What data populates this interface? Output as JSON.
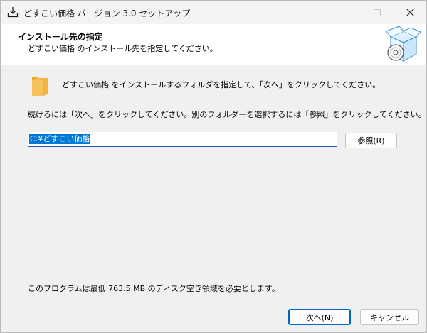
{
  "window": {
    "title": "どすこい価格 バージョン 3.0 セットアップ",
    "controls": {
      "minimize": "—",
      "maximize": "☐",
      "close": "✕"
    }
  },
  "header": {
    "title": "インストール先の指定",
    "subtitle": "どすこい価格 のインストール先を指定してください。",
    "graphic_icon": "installer-box-cd-icon"
  },
  "body": {
    "folder_icon": "folder-icon",
    "intro": "どすこい価格 をインストールするフォルダを指定して、「次へ」をクリックしてください。",
    "continue_text": "続けるには「次へ」をクリックしてください。別のフォルダーを選択するには「参照」をクリックしてください。",
    "install_path": "C:¥どすこい価格",
    "browse_label": "参照(R)",
    "space_required": "このプログラムは最低 763.5 MB のディスク空き領域を必要とします。"
  },
  "footer": {
    "next_label": "次へ(N)",
    "cancel_label": "キャンセル"
  },
  "colors": {
    "accent": "#0067c0",
    "selection": "#0078d7",
    "folder": "#f3b33d"
  }
}
